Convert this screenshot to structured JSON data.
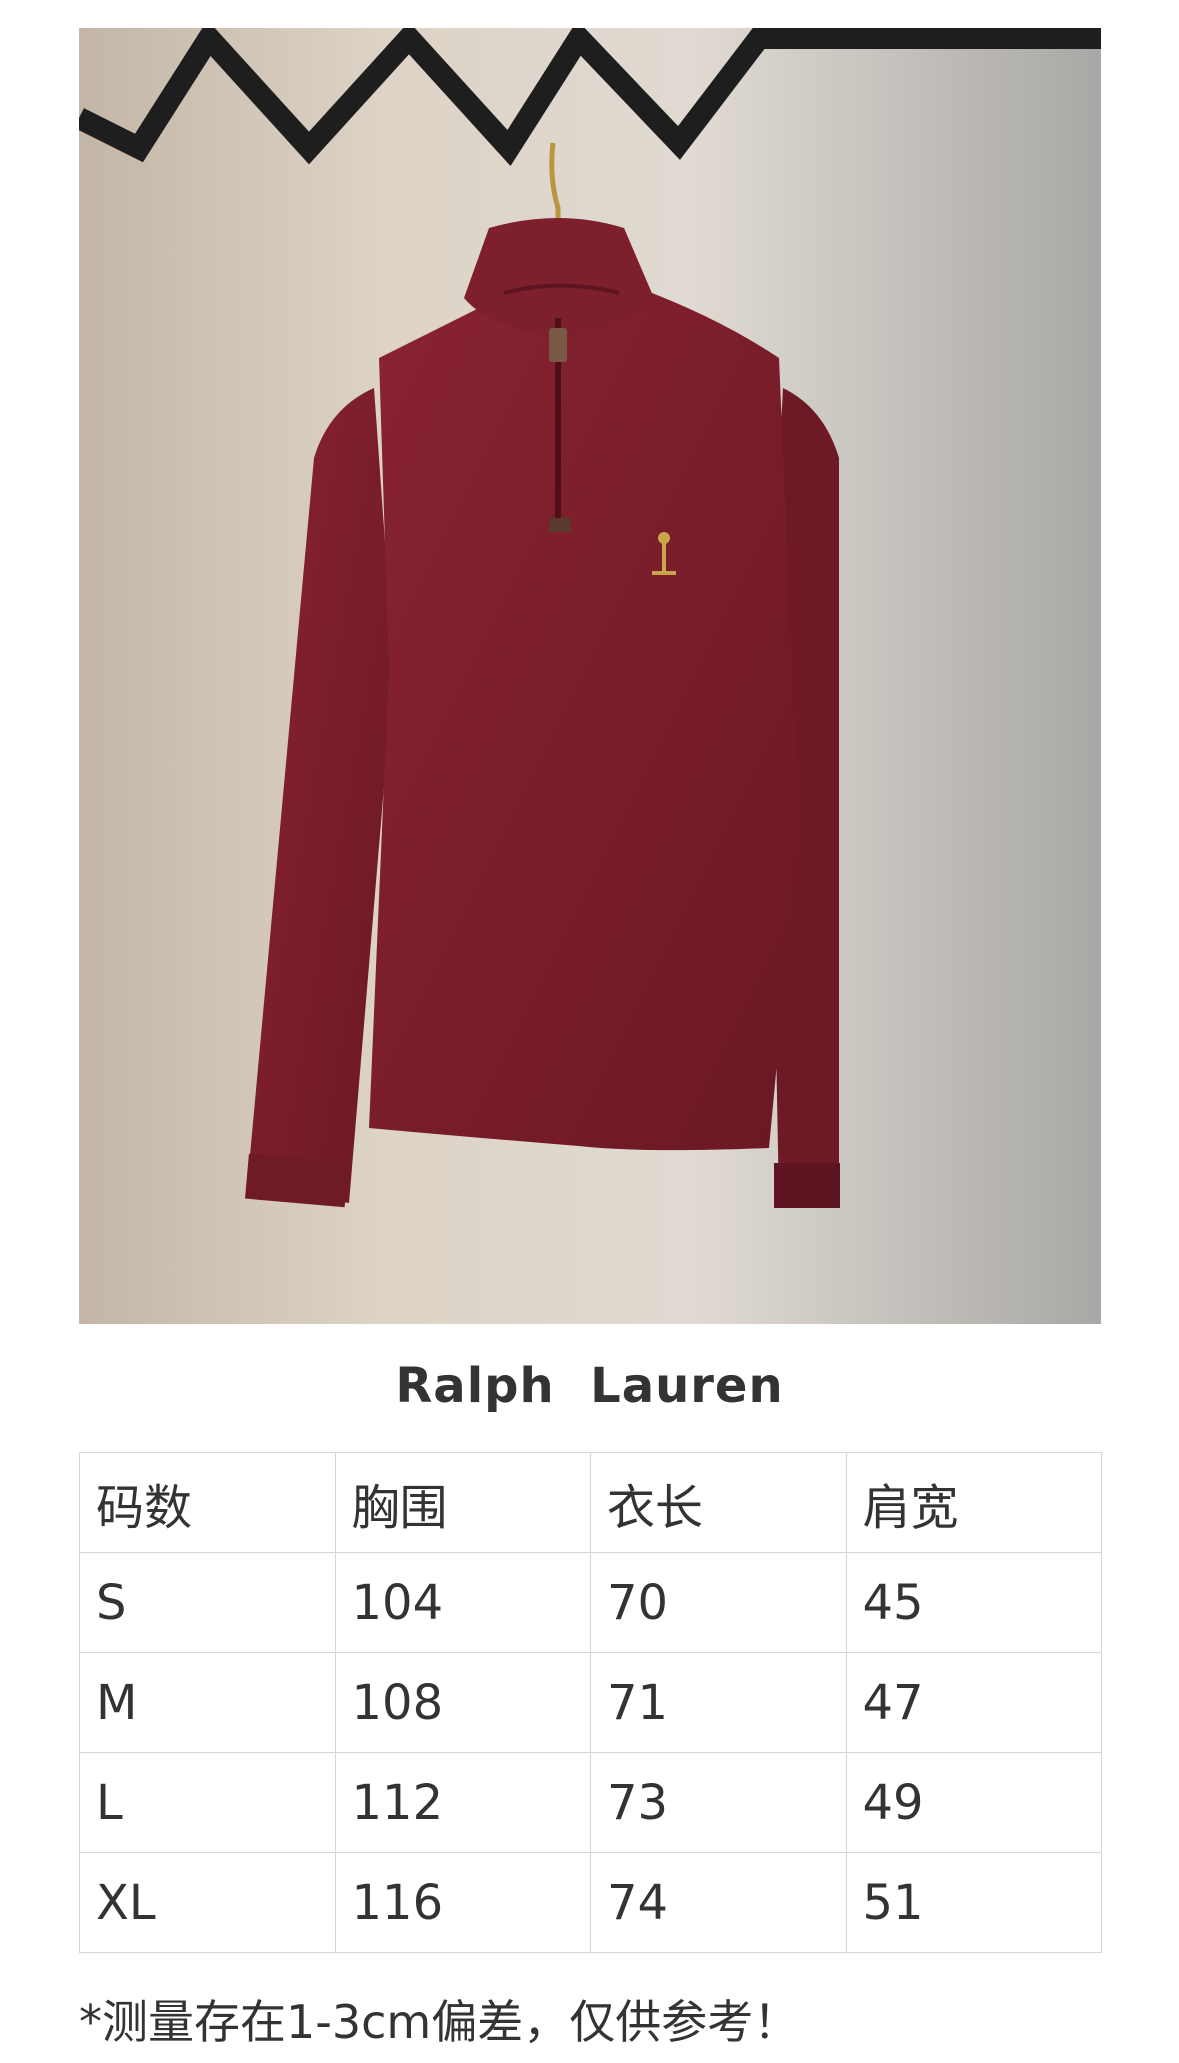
{
  "product_photo": {
    "description_icon": "hanging-sweater-photo",
    "colors": {
      "sweater": "#7e1e2b",
      "rack": "#1e1e1e",
      "background": "#d9d0c4",
      "logo": "#c9a64a"
    }
  },
  "brand": "Ralph  Lauren",
  "size_table": {
    "headers": [
      "码数",
      "胸围",
      "衣长",
      "肩宽"
    ],
    "rows": [
      [
        "S",
        "104",
        "70",
        "45"
      ],
      [
        "M",
        "108",
        "71",
        "47"
      ],
      [
        "L",
        "112",
        "73",
        "49"
      ],
      [
        "XL",
        "116",
        "74",
        "51"
      ]
    ]
  },
  "note": "*测量存在1-3cm偏差，仅供参考！"
}
